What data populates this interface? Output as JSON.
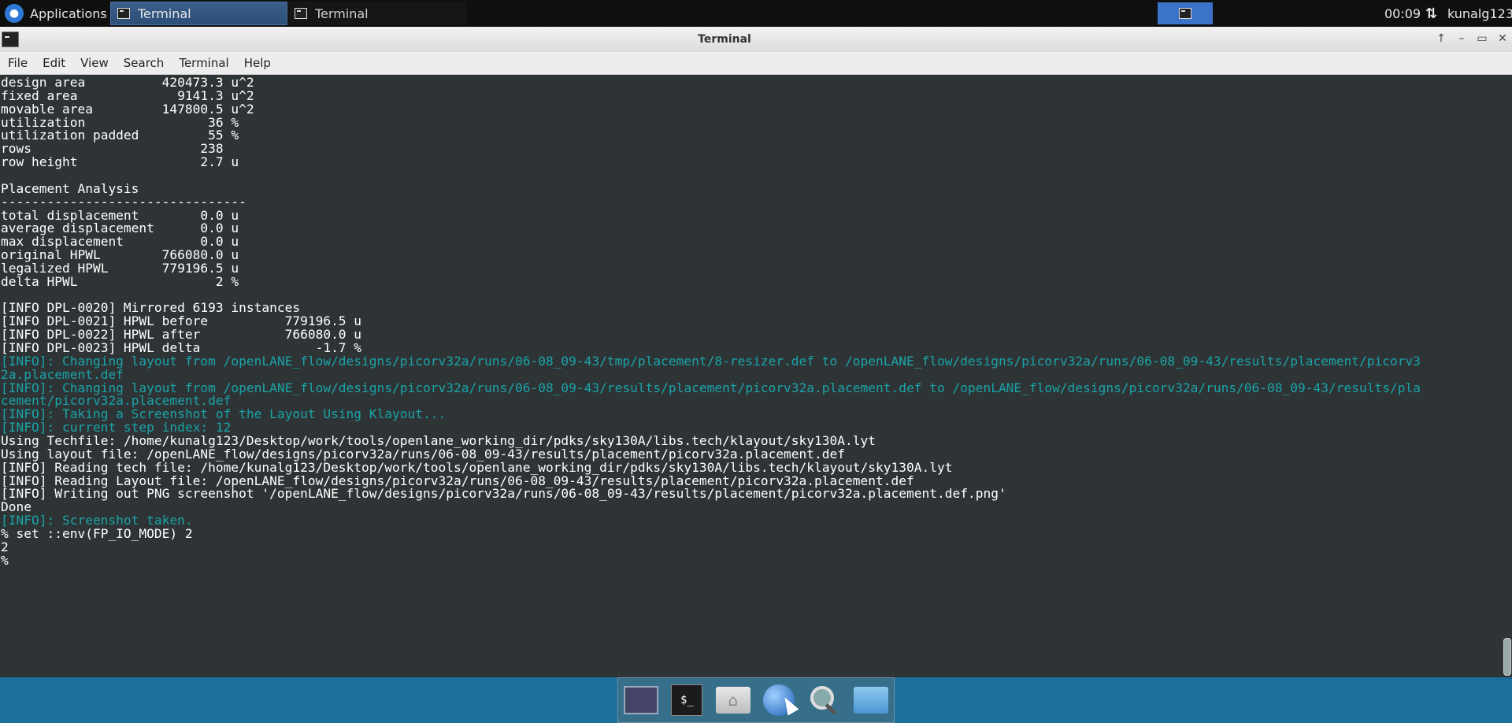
{
  "top_panel": {
    "applications_label": "Applications",
    "tasks": [
      {
        "label": "Terminal",
        "active": true
      },
      {
        "label": "Terminal",
        "active": false
      }
    ],
    "clock": "00:09",
    "user": "kunalg123",
    "network_icon": "network-arrows-icon"
  },
  "window": {
    "title": "Terminal",
    "menu": [
      "File",
      "Edit",
      "View",
      "Search",
      "Terminal",
      "Help"
    ],
    "controls": [
      "↑",
      "–",
      "▭",
      "✕"
    ]
  },
  "terminal": {
    "colors": {
      "background": "#2e3436",
      "text": "#ffffff",
      "info": "#1aa3a7"
    },
    "lines": [
      {
        "text": "design area          420473.3 u^2",
        "style": "normal"
      },
      {
        "text": "fixed area             9141.3 u^2",
        "style": "normal"
      },
      {
        "text": "movable area         147800.5 u^2",
        "style": "normal"
      },
      {
        "text": "utilization                36 %",
        "style": "normal"
      },
      {
        "text": "utilization padded         55 %",
        "style": "normal"
      },
      {
        "text": "rows                      238",
        "style": "normal"
      },
      {
        "text": "row height                2.7 u",
        "style": "normal"
      },
      {
        "text": "",
        "style": "normal"
      },
      {
        "text": "Placement Analysis",
        "style": "normal"
      },
      {
        "text": "--------------------------------",
        "style": "normal"
      },
      {
        "text": "total displacement        0.0 u",
        "style": "normal"
      },
      {
        "text": "average displacement      0.0 u",
        "style": "normal"
      },
      {
        "text": "max displacement          0.0 u",
        "style": "normal"
      },
      {
        "text": "original HPWL        766080.0 u",
        "style": "normal"
      },
      {
        "text": "legalized HPWL       779196.5 u",
        "style": "normal"
      },
      {
        "text": "delta HPWL                  2 %",
        "style": "normal"
      },
      {
        "text": "",
        "style": "normal"
      },
      {
        "text": "[INFO DPL-0020] Mirrored 6193 instances",
        "style": "normal"
      },
      {
        "text": "[INFO DPL-0021] HPWL before          779196.5 u",
        "style": "normal"
      },
      {
        "text": "[INFO DPL-0022] HPWL after           766080.0 u",
        "style": "normal"
      },
      {
        "text": "[INFO DPL-0023] HPWL delta               -1.7 %",
        "style": "normal"
      },
      {
        "text": "[INFO]: Changing layout from /openLANE_flow/designs/picorv32a/runs/06-08_09-43/tmp/placement/8-resizer.def to /openLANE_flow/designs/picorv32a/runs/06-08_09-43/results/placement/picorv3",
        "style": "info"
      },
      {
        "text": "2a.placement.def",
        "style": "info"
      },
      {
        "text": "[INFO]: Changing layout from /openLANE_flow/designs/picorv32a/runs/06-08_09-43/results/placement/picorv32a.placement.def to /openLANE_flow/designs/picorv32a/runs/06-08_09-43/results/pla",
        "style": "info"
      },
      {
        "text": "cement/picorv32a.placement.def",
        "style": "info"
      },
      {
        "text": "[INFO]: Taking a Screenshot of the Layout Using Klayout...",
        "style": "info"
      },
      {
        "text": "[INFO]: current step index: 12",
        "style": "info"
      },
      {
        "text": "Using Techfile: /home/kunalg123/Desktop/work/tools/openlane_working_dir/pdks/sky130A/libs.tech/klayout/sky130A.lyt",
        "style": "normal"
      },
      {
        "text": "Using layout file: /openLANE_flow/designs/picorv32a/runs/06-08_09-43/results/placement/picorv32a.placement.def",
        "style": "normal"
      },
      {
        "text": "[INFO] Reading tech file: /home/kunalg123/Desktop/work/tools/openlane_working_dir/pdks/sky130A/libs.tech/klayout/sky130A.lyt",
        "style": "normal"
      },
      {
        "text": "[INFO] Reading Layout file: /openLANE_flow/designs/picorv32a/runs/06-08_09-43/results/placement/picorv32a.placement.def",
        "style": "normal"
      },
      {
        "text": "[INFO] Writing out PNG screenshot '/openLANE_flow/designs/picorv32a/runs/06-08_09-43/results/placement/picorv32a.placement.def.png'",
        "style": "normal"
      },
      {
        "text": "Done",
        "style": "normal"
      },
      {
        "text": "[INFO]: Screenshot taken.",
        "style": "info"
      },
      {
        "text": "% set ::env(FP_IO_MODE) 2",
        "style": "normal"
      },
      {
        "text": "2",
        "style": "normal"
      },
      {
        "text": "%",
        "style": "normal"
      }
    ]
  },
  "dock": {
    "items": [
      {
        "name": "desktop-icon"
      },
      {
        "name": "terminal-icon",
        "label": "$_"
      },
      {
        "name": "home-folder-icon"
      },
      {
        "name": "web-browser-icon"
      },
      {
        "name": "search-icon"
      },
      {
        "name": "folder-icon"
      }
    ]
  }
}
